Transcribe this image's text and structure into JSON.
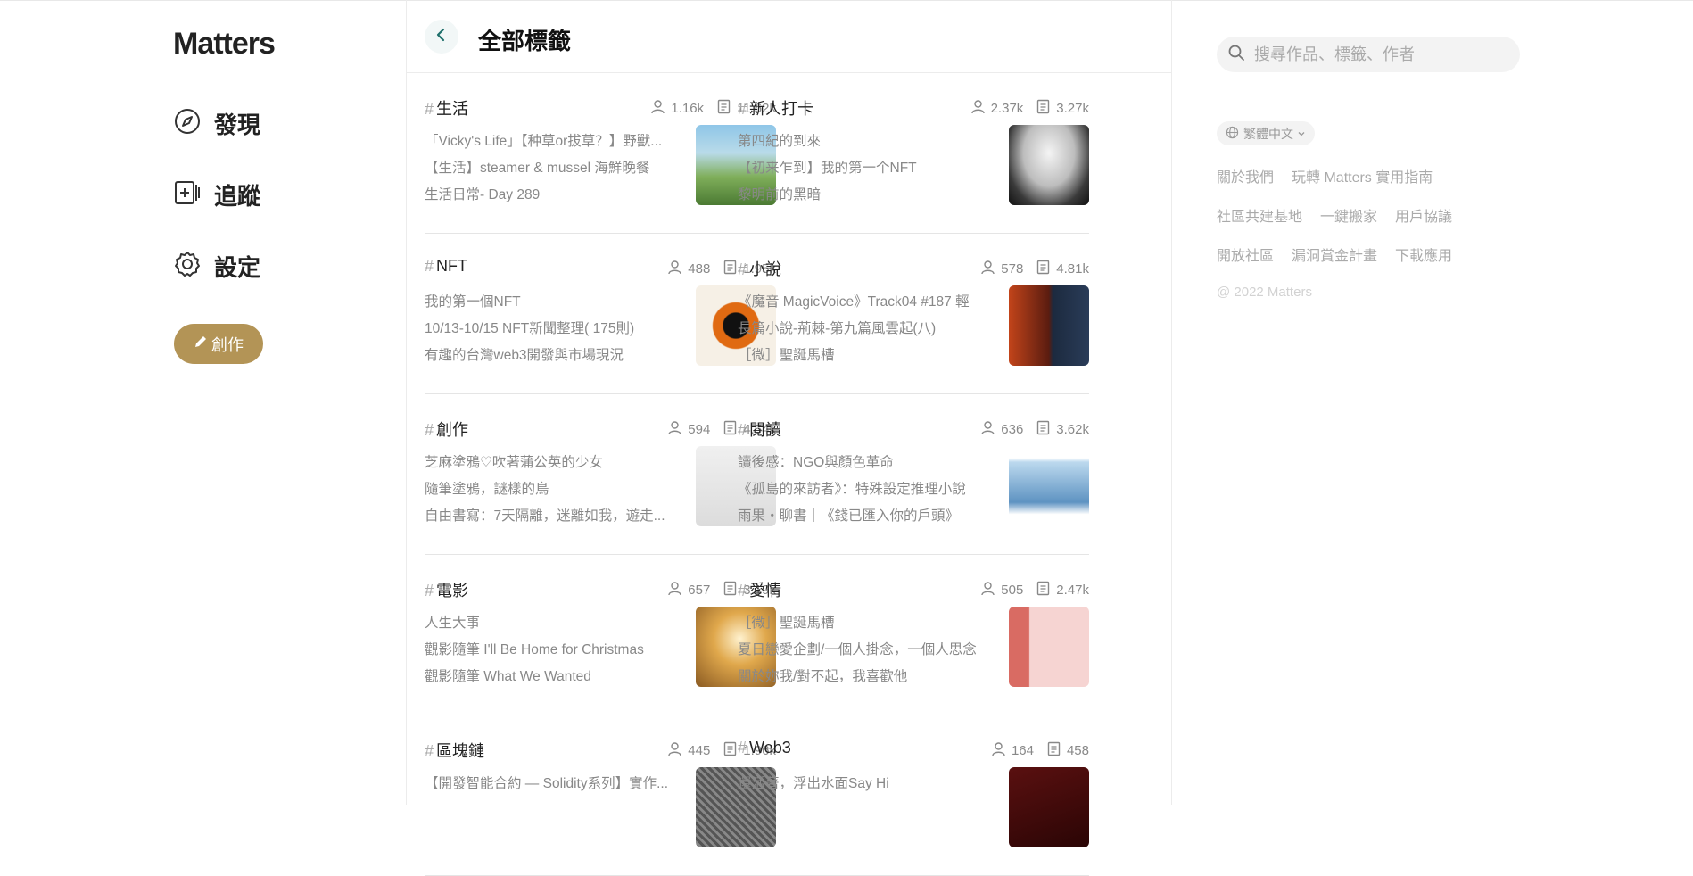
{
  "app": {
    "logo": "Matters"
  },
  "nav": {
    "items": [
      {
        "label": "發現",
        "icon": "compass-icon"
      },
      {
        "label": "追蹤",
        "icon": "follow-icon"
      },
      {
        "label": "設定",
        "icon": "gear-icon"
      }
    ],
    "create_label": "創作"
  },
  "header": {
    "title": "全部標籤"
  },
  "tags": [
    {
      "name": "生活",
      "users": "1.16k",
      "articles": "11.62k",
      "lines": [
        "「Vicky's Life」【种草or拔草？】野獸...",
        "【生活】steamer & mussel 海鮮晚餐",
        "生活日常- Day 289"
      ]
    },
    {
      "name": "新人打卡",
      "users": "2.37k",
      "articles": "3.27k",
      "lines": [
        "第四紀的到來",
        "【初来乍到】我的第一个NFT",
        "黎明前的黑暗"
      ]
    },
    {
      "name": "NFT",
      "users": "488",
      "articles": "1.95k",
      "lines": [
        "我的第一個NFT",
        "10/13-10/15 NFT新聞整理( 175則)",
        "有趣的台灣web3開發與市場現況"
      ]
    },
    {
      "name": "小說",
      "users": "578",
      "articles": "4.81k",
      "lines": [
        "《魔音 MagicVoice》Track04 #187 輕",
        "長篇小說-荊棘-第九篇風雲起(八)",
        "［微］聖誕馬槽"
      ]
    },
    {
      "name": "創作",
      "users": "594",
      "articles": "4.54k",
      "lines": [
        "芝麻塗鴉♡吹著蒲公英的少女",
        "隨筆塗鴉，謎樣的鳥",
        "自由書寫：7天隔離，迷離如我，遊走..."
      ]
    },
    {
      "name": "閱讀",
      "users": "636",
      "articles": "3.62k",
      "lines": [
        "讀後感：NGO與顏色革命",
        "《孤島的來訪者》：特殊設定推理小說",
        "雨果・聊書｜《錢已匯入你的戶頭》"
      ]
    },
    {
      "name": "電影",
      "users": "657",
      "articles": "3.19k",
      "lines": [
        "人生大事",
        "觀影隨筆 I'll Be Home for Christmas",
        "觀影隨筆 What We Wanted"
      ]
    },
    {
      "name": "愛情",
      "users": "505",
      "articles": "2.47k",
      "lines": [
        "［微］聖誕馬槽",
        "夏日戀愛企劃/一個人掛念，一個人思念",
        "關於妳我/對不起，我喜歡他"
      ]
    },
    {
      "name": "區塊鏈",
      "users": "445",
      "articles": "1.96k",
      "lines": [
        "【開發智能合約 — Solidity系列】實作...",
        "",
        ""
      ]
    },
    {
      "name": "Web3",
      "users": "164",
      "articles": "458",
      "lines": [
        "還活著，浮出水面Say Hi",
        "",
        ""
      ]
    }
  ],
  "search": {
    "placeholder": "搜尋作品、標籤、作者"
  },
  "sidebar": {
    "language": "繁體中文",
    "links_row1": [
      "關於我們",
      "玩轉 Matters 實用指南"
    ],
    "links_row2": [
      "社區共建基地",
      "一鍵搬家",
      "用戶協議"
    ],
    "links_row3": [
      "開放社區",
      "漏洞賞金計畫",
      "下載應用"
    ],
    "copyright": "@ 2022 Matters"
  },
  "colors": {
    "accent": "#b39456",
    "back_button_bg": "#f2f7f7",
    "back_chevron": "#1f6f6b"
  }
}
